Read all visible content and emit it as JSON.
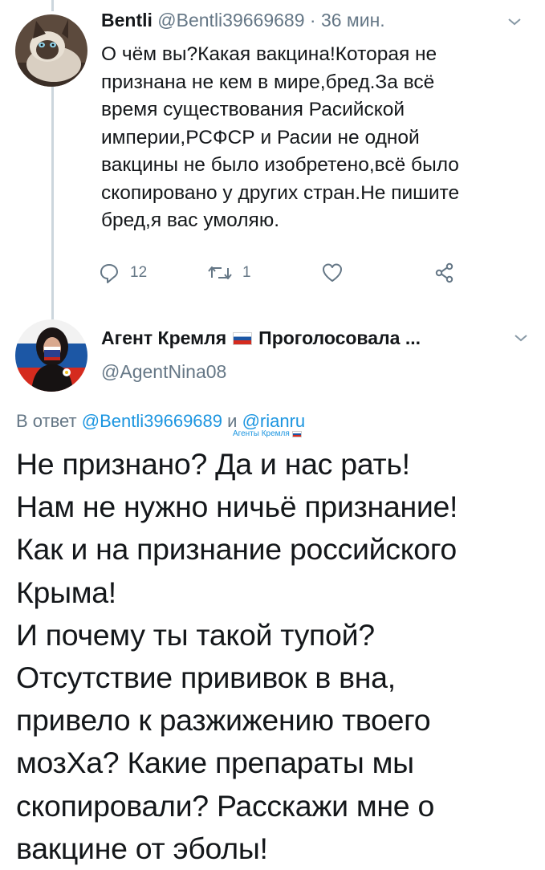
{
  "tweet1": {
    "author_name": "Bentli",
    "handle": "@Bentli39669689",
    "separator": "·",
    "time": "36 мин.",
    "text": "О чём вы?Какая вакцина!Которая не\nпризнана не кем в мире,бред.За всё\nвремя существования  Расийской\nимперии,РСФСР и Расии не одной\nвакцины не было изобретено,всё было\nскопировано у других стран.Не пишите\nбред,я вас умоляю.",
    "actions": {
      "reply_count": "12",
      "retweet_count": "1"
    },
    "icons": {
      "reply": "reply-icon",
      "retweet": "retweet-icon",
      "like": "heart-icon",
      "share": "share-icon",
      "menu": "chevron-down-icon"
    }
  },
  "tweet2": {
    "author_name": "Агент Кремля",
    "display_suffix": "Проголосовала ...",
    "handle": "@AgentNina08",
    "reply_prefix": "В ответ",
    "reply_user1": "@Bentli39669689",
    "reply_conj": "и",
    "reply_user2": "@rianru",
    "agent_label": "Агенты Кремля",
    "text": "Не признано? Да и нас рать!\nНам не нужно ничьё признание!\nКак и на признание российского\nКрыма!\nИ почему ты такой тупой?\nОтсутствие прививок в вна,\nпривело к разжижению твоего\nмозХа? Какие препараты мы\nскопировали? Расскажи мне о\nвакцине от эболы!"
  },
  "colors": {
    "text": "#14171a",
    "secondary": "#657786",
    "link": "#1b95e0",
    "thread_line": "#ccd6dd"
  }
}
